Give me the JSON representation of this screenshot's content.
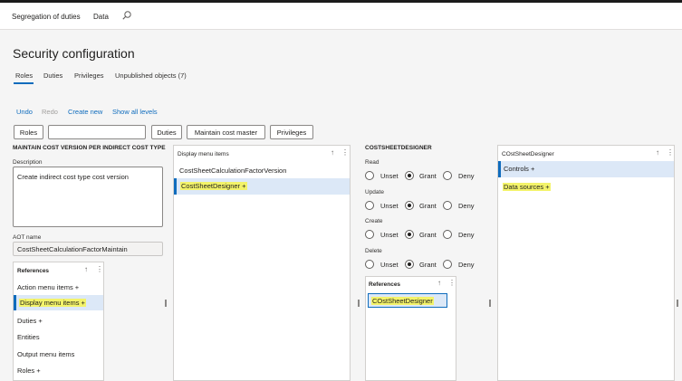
{
  "nav": {
    "module": "Segregation of duties",
    "data_link": "Data",
    "search_icon": "search-icon"
  },
  "page": {
    "title": "Security configuration"
  },
  "tabs": [
    {
      "label": "Roles"
    },
    {
      "label": "Duties"
    },
    {
      "label": "Privileges"
    },
    {
      "label": "Unpublished objects (7)"
    }
  ],
  "actions": {
    "undo": "Undo",
    "redo": "Redo",
    "create_new": "Create new",
    "show_all": "Show all levels"
  },
  "toolbar": {
    "roles": "Roles",
    "duties": "Duties",
    "maintain": "Maintain cost master",
    "privileges": "Privileges",
    "filter_value": ""
  },
  "left": {
    "heading": "MAINTAIN COST VERSION PER INDIRECT COST TYPE",
    "description_label": "Description",
    "description_value": "Create indirect cost type cost version",
    "aot_label": "AOT name",
    "aot_value": "CostSheetCalculationFactorMaintain",
    "references_title": "References",
    "references": [
      "Action menu items +",
      "Display menu items +",
      "Duties +",
      "Entities",
      "Output menu items",
      "Roles +"
    ]
  },
  "display_panel": {
    "title": "Display menu items",
    "items": [
      "CostSheetCalculationFactorVersion",
      "CostSheetDesigner +"
    ]
  },
  "access": {
    "heading": "COSTSHEETDESIGNER",
    "groups": [
      {
        "label": "Read"
      },
      {
        "label": "Update"
      },
      {
        "label": "Create"
      },
      {
        "label": "Delete"
      }
    ],
    "options": {
      "unset": "Unset",
      "grant": "Grant",
      "deny": "Deny"
    },
    "references_title": "References",
    "reference_item": "COstSheetDesigner"
  },
  "right_panel": {
    "title": "COstSheetDesigner",
    "items": [
      "Controls +",
      "Data sources +"
    ]
  },
  "icons": {
    "sort": "↑",
    "more": "⋮"
  }
}
